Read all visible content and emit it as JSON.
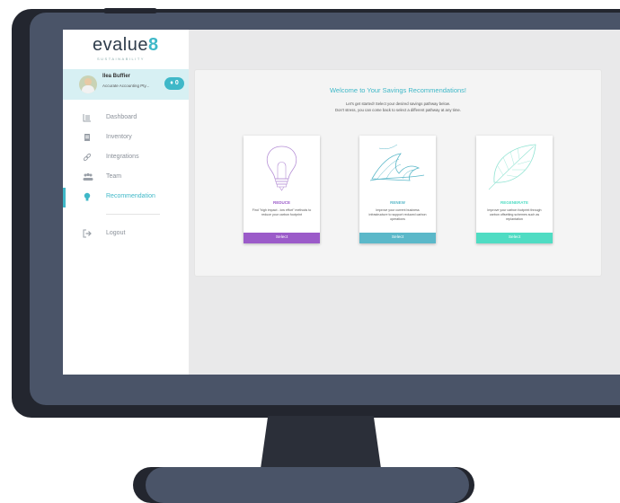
{
  "brand": {
    "logo_text": "evalue",
    "logo_mark": "8",
    "logo_sub": "SUSTAINABILITY"
  },
  "user": {
    "name": "Ilea Buffier",
    "company": "Accurate Accounting Pty...",
    "notifications": "0"
  },
  "nav": {
    "items": [
      {
        "label": "Dashboard",
        "icon": "dashboard-icon"
      },
      {
        "label": "Inventory",
        "icon": "inventory-icon"
      },
      {
        "label": "Integrations",
        "icon": "link-icon"
      },
      {
        "label": "Team",
        "icon": "team-icon"
      },
      {
        "label": "Recommendation",
        "icon": "lightbulb-icon",
        "active": true
      }
    ],
    "logout": {
      "label": "Logout",
      "icon": "logout-icon"
    }
  },
  "main": {
    "title": "Welcome to Your Savings Recommendations!",
    "intro_line1": "Let's get started! Select your desired savings pathway below.",
    "intro_line2": "Don't stress, you can come back to select a different pathway at any time.",
    "cards": [
      {
        "title": "REDUCE",
        "desc": "Find \"high impact - low effort\" methods to reduce your carbon footprint",
        "button": "Select",
        "color": "#9b5bc9",
        "icon": "lightbulb-icon"
      },
      {
        "title": "RENEW",
        "desc": "Improve your current business infrastructure to support reduced carbon operations",
        "button": "Select",
        "color": "#5bb8c9",
        "icon": "wave-icon"
      },
      {
        "title": "REGENERATE",
        "desc": "Improve your carbon footprint through carbon offsetting schemes such as replantation",
        "button": "Select",
        "color": "#4fdcc3",
        "icon": "leaf-icon"
      }
    ]
  },
  "colors": {
    "accent": "#3fb8c8",
    "reduce": "#9b5bc9",
    "renew": "#5bb8c9",
    "regenerate": "#4fdcc3"
  }
}
